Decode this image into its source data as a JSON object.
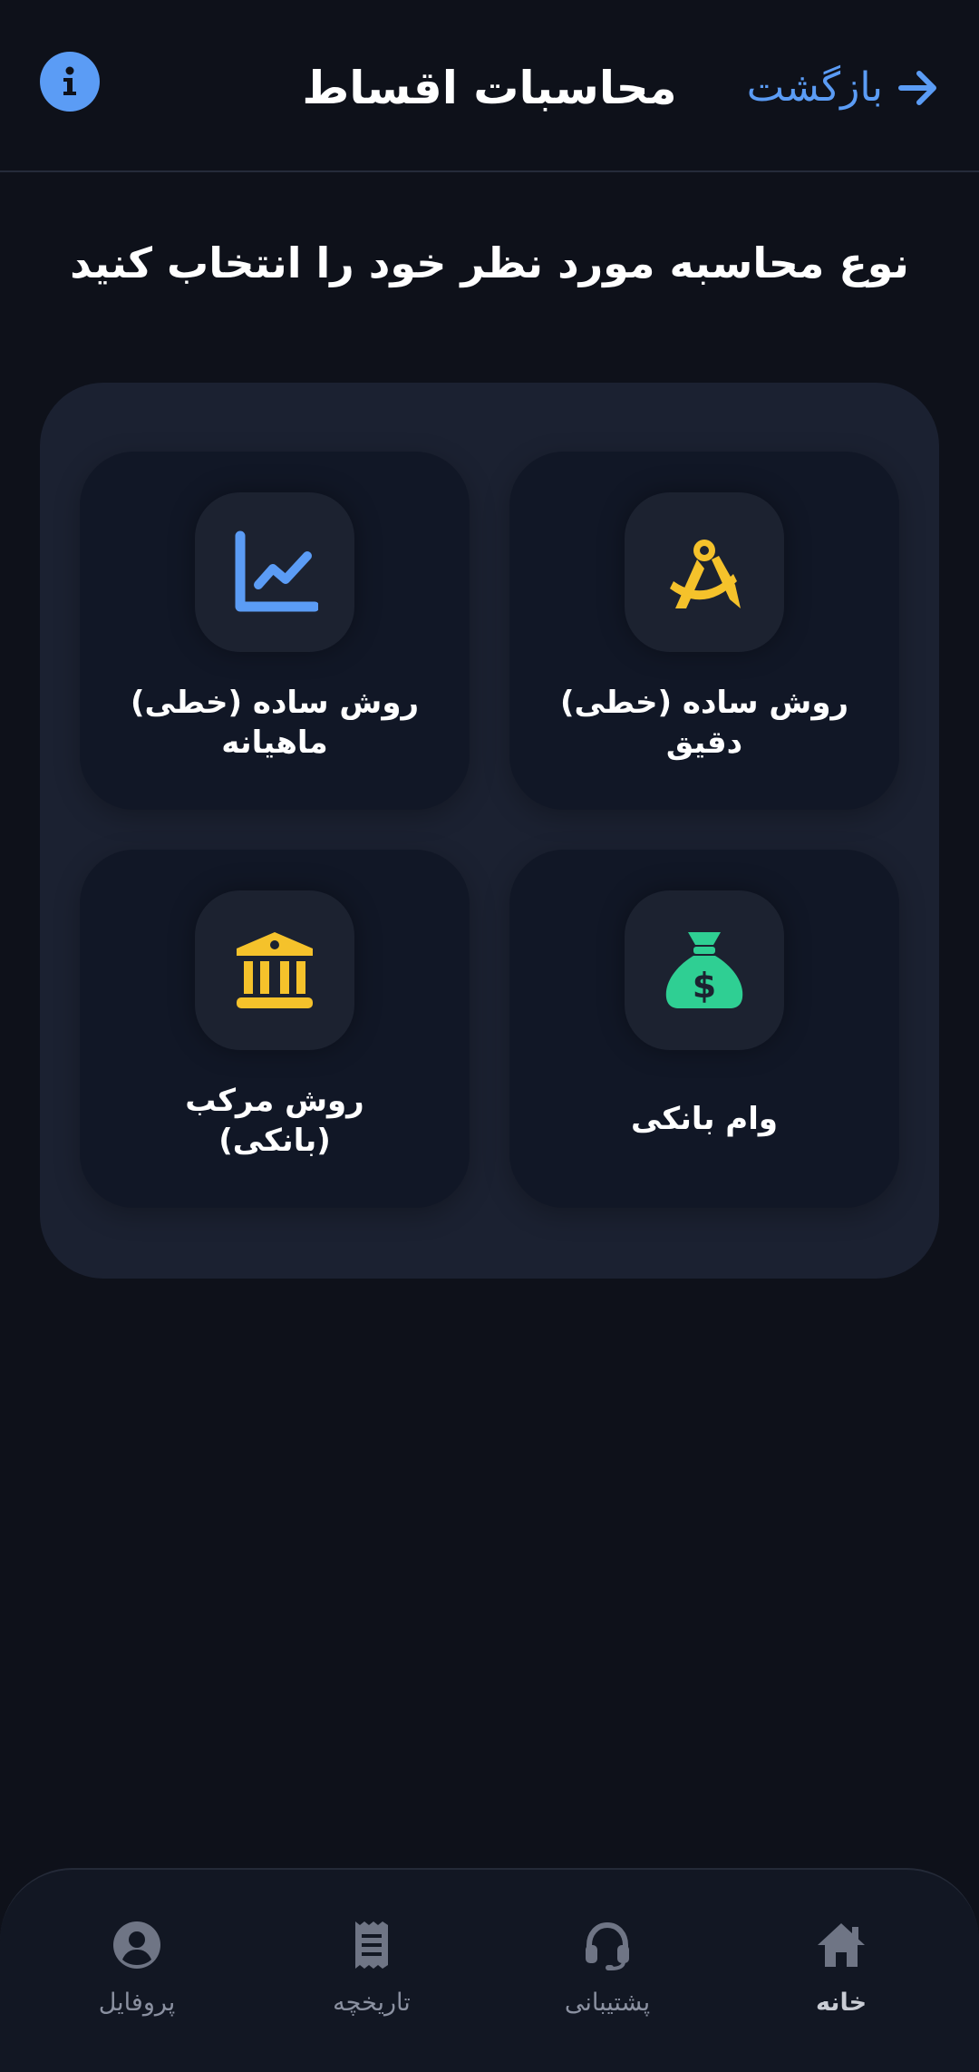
{
  "header": {
    "back_label": "بازگشت",
    "title": "محاسبات اقساط",
    "info_icon": "info-icon"
  },
  "subtitle": "نوع محاسبه مورد نظر خود را انتخاب کنید",
  "cards": [
    {
      "id": "simple-exact",
      "line1": "روش ساده (خطی)",
      "line2": "دقیق",
      "icon": "compass-icon",
      "icon_color": "#f5c22b"
    },
    {
      "id": "simple-monthly",
      "line1": "روش ساده (خطی)",
      "line2": "ماهیانه",
      "icon": "line-chart-icon",
      "icon_color": "#5b9cf5"
    },
    {
      "id": "bank-loan",
      "line1": "وام بانکی",
      "line2": "",
      "icon": "money-bag-icon",
      "icon_color": "#2fcf93"
    },
    {
      "id": "compound-bank",
      "line1": "روش مرکب",
      "line2": "(بانکی)",
      "icon": "bank-building-icon",
      "icon_color": "#f5c22b"
    }
  ],
  "nav": {
    "home": "خانه",
    "support": "پشتیبانی",
    "history": "تاریخچه",
    "profile": "پروفایل",
    "active": "home"
  },
  "colors": {
    "background": "#0e111a",
    "panel": "#1b2131",
    "card": "#111726",
    "accent_blue": "#5b9cf5",
    "accent_yellow": "#f5c22b",
    "accent_green": "#2fcf93",
    "nav_icon": "#6f7585"
  }
}
